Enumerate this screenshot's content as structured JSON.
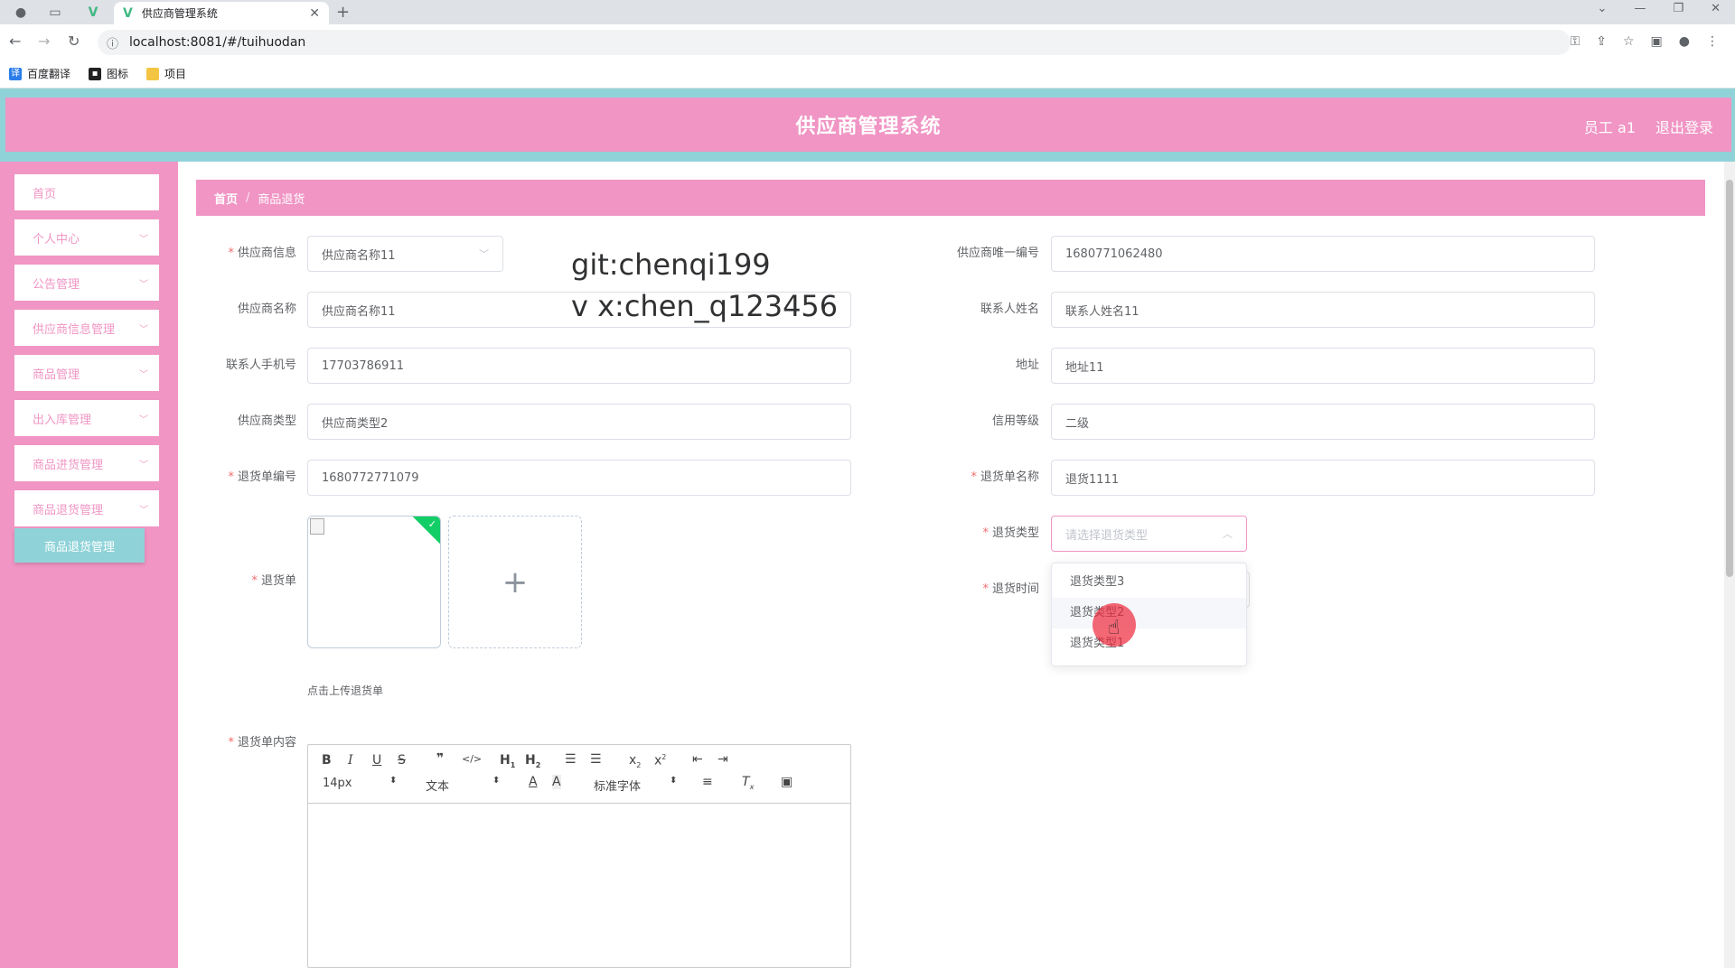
{
  "browser": {
    "tab_title": "供应商管理系统",
    "url": "localhost:8081/#/tuihuodan",
    "bookmarks": [
      "百度翻译",
      "图标",
      "项目"
    ]
  },
  "app": {
    "title": "供应商管理系统",
    "user": "员工 a1",
    "logout": "退出登录"
  },
  "sidebar": {
    "items": [
      "首页",
      "个人中心",
      "公告管理",
      "供应商信息管理",
      "商品管理",
      "出入库管理",
      "商品进货管理",
      "商品退货管理"
    ],
    "active_sub": "商品退货管理"
  },
  "breadcrumb": {
    "home": "首页",
    "current": "商品退货"
  },
  "watermark": {
    "line1": "git:chenqi199",
    "line2": "v x:chen_q123456"
  },
  "form": {
    "supplier_info": {
      "label": "供应商信息",
      "value": "供应商名称11"
    },
    "supplier_id": {
      "label": "供应商唯一编号",
      "value": "1680771062480"
    },
    "supplier_name": {
      "label": "供应商名称",
      "value": "供应商名称11"
    },
    "contact_name": {
      "label": "联系人姓名",
      "value": "联系人姓名11"
    },
    "contact_phone": {
      "label": "联系人手机号",
      "value": "17703786911"
    },
    "address": {
      "label": "地址",
      "value": "地址11"
    },
    "supplier_type": {
      "label": "供应商类型",
      "value": "供应商类型2"
    },
    "credit_level": {
      "label": "信用等级",
      "value": "二级"
    },
    "return_no": {
      "label": "退货单编号",
      "value": "1680772771079"
    },
    "return_name": {
      "label": "退货单名称",
      "value": "退货1111"
    },
    "return_type": {
      "label": "退货类型",
      "placeholder": "请选择退货类型"
    },
    "return_time": {
      "label": "退货时间"
    },
    "return_doc": {
      "label": "退货单",
      "tip": "点击上传退货单"
    },
    "return_content": {
      "label": "退货单内容"
    }
  },
  "dropdown": {
    "options": [
      "退货类型3",
      "退货类型2",
      "退货类型1"
    ],
    "hovered_index": 1
  },
  "editor": {
    "font_size": "14px",
    "header": "文本",
    "font": "标准字体"
  },
  "colors": {
    "brand": "#f095c4",
    "accent": "#8fd3d9",
    "required": "#f56c6c",
    "success": "#13ce66"
  }
}
